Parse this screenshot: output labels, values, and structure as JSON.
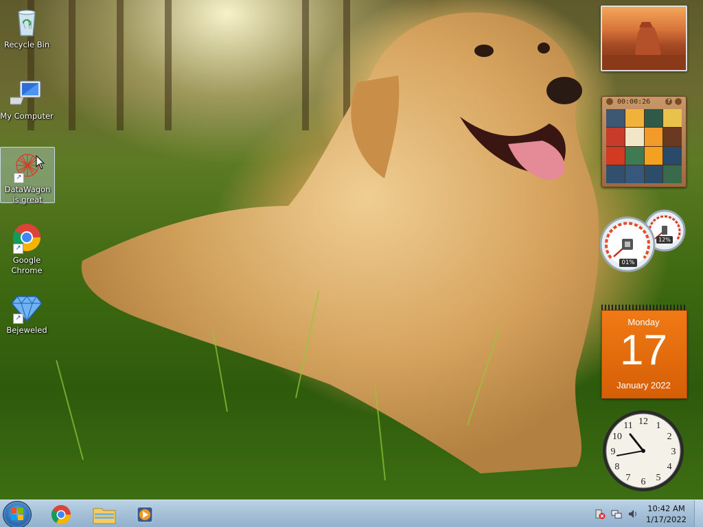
{
  "desktop": {
    "icons": [
      {
        "label": "Recycle Bin",
        "icon": "recycle-bin-icon"
      },
      {
        "label": "My Computer",
        "icon": "computer-icon"
      },
      {
        "label": "DataWagon is great",
        "icon": "datawagon-icon",
        "shortcut": true,
        "selected": true
      },
      {
        "label": "Google Chrome",
        "icon": "chrome-icon",
        "shortcut": true
      },
      {
        "label": "Bejeweled",
        "icon": "bejeweled-icon",
        "shortcut": true
      }
    ]
  },
  "gadgets": {
    "puzzle": {
      "timer": "00:00:26"
    },
    "meter": {
      "cpu": "01%",
      "memory": "12%"
    },
    "calendar": {
      "weekday": "Monday",
      "day": "17",
      "month_year": "January 2022"
    },
    "clock": {
      "numerals": [
        "12",
        "1",
        "2",
        "3",
        "4",
        "5",
        "6",
        "7",
        "8",
        "9",
        "10",
        "11"
      ],
      "time": "10:42"
    }
  },
  "taskbar": {
    "pinned": [
      {
        "name": "chrome-taskbar-button",
        "icon": "chrome-icon"
      },
      {
        "name": "explorer-taskbar-button",
        "icon": "folder-icon"
      },
      {
        "name": "media-player-taskbar-button",
        "icon": "media-player-icon"
      }
    ],
    "tray": {
      "icons": [
        "action-center-icon",
        "network-icon",
        "volume-icon"
      ],
      "time": "10:42 AM",
      "date": "1/17/2022"
    }
  },
  "colors": {
    "taskbar": "#a8c2dc",
    "calendar_orange": "#e8720c",
    "selection": "#c8dcf0"
  }
}
